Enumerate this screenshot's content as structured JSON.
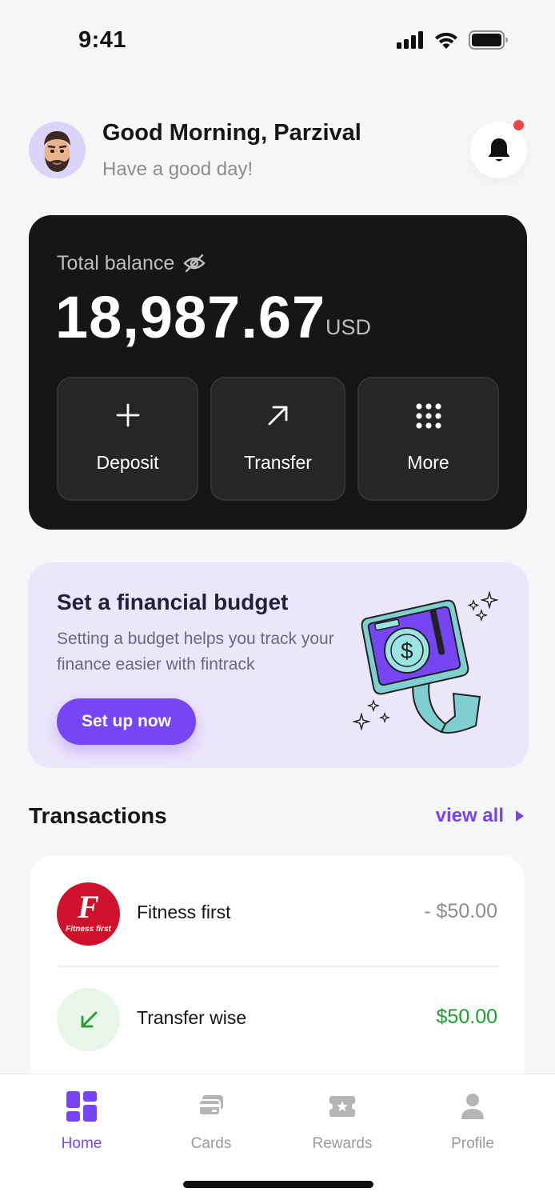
{
  "status_bar": {
    "time": "9:41"
  },
  "header": {
    "greeting": "Good Morning, Parzival",
    "subtitle": "Have a good day!"
  },
  "balance": {
    "label": "Total balance",
    "amount": "18,987.67",
    "currency": "USD",
    "actions": [
      {
        "label": "Deposit",
        "icon": "plus-icon"
      },
      {
        "label": "Transfer",
        "icon": "arrow-up-right-icon"
      },
      {
        "label": "More",
        "icon": "grid-dots-icon"
      }
    ]
  },
  "budget": {
    "title": "Set a financial budget",
    "description": "Setting a budget helps you track your finance easier with fintrack",
    "button": "Set up now"
  },
  "transactions": {
    "title": "Transactions",
    "view_all": "view all",
    "items": [
      {
        "name": "Fitness first",
        "amount": "- $50.00",
        "logo_text": "F",
        "logo_caption": "Fitness first",
        "amount_color": "#8D8D8D"
      },
      {
        "name": "Transfer wise",
        "amount": "$50.00",
        "amount_color": "#1E9E2E"
      }
    ]
  },
  "tabs": [
    {
      "label": "Home",
      "icon": "home-grid-icon",
      "active": true
    },
    {
      "label": "Cards",
      "icon": "cards-icon",
      "active": false
    },
    {
      "label": "Rewards",
      "icon": "ticket-icon",
      "active": false
    },
    {
      "label": "Profile",
      "icon": "user-icon",
      "active": false
    }
  ],
  "colors": {
    "accent": "#7646F4",
    "card_dark": "#161616",
    "budget_bg": "#ECE6FA",
    "positive": "#1E9E2E",
    "notification": "#EF4444"
  }
}
